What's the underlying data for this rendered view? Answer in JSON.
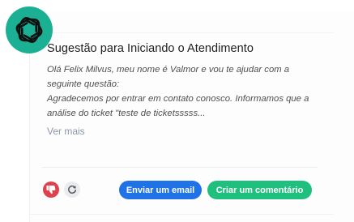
{
  "colors": {
    "logo_bg": "#1bb093",
    "email_button": "#1f73e6",
    "comment_button": "#1fbf7e",
    "dislike_button": "#e0424d",
    "refresh_button": "#e9ebee"
  },
  "icons": {
    "logo": "openai-logo-icon",
    "dislike": "thumbs-down-icon",
    "refresh": "refresh-icon"
  },
  "suggestion": {
    "title": "Sugestão para Iniciando o Atendimento",
    "paragraph1": "Olá Felix Milvus, meu nome é Valmor e vou te ajudar com a seguinte questão:",
    "paragraph2": "Agradecemos por entrar em contato conosco. Informamos que a análise do ticket \"teste de ticketsssss...",
    "see_more": "Ver mais"
  },
  "actions": {
    "email_label": "Enviar um email",
    "comment_label": "Criar um comentário"
  }
}
